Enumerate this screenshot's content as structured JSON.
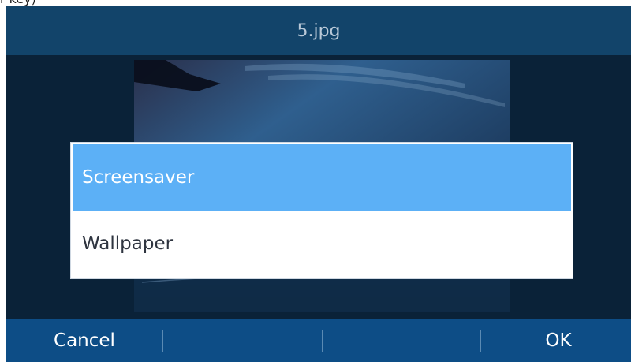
{
  "caption_fragment": "r key)",
  "title": "5.jpg",
  "preview": {
    "file": "5.jpg"
  },
  "dialog": {
    "options": [
      {
        "label": "Screensaver",
        "selected": true
      },
      {
        "label": "Wallpaper",
        "selected": false
      }
    ]
  },
  "softkeys": {
    "left": "Cancel",
    "middle_left": "",
    "middle_right": "",
    "right": "OK"
  },
  "colors": {
    "title_bar": "#12446a",
    "softkey_bar": "#0d4d86",
    "selected_option": "#5cb0f6",
    "screen_background": "#0a2238"
  }
}
